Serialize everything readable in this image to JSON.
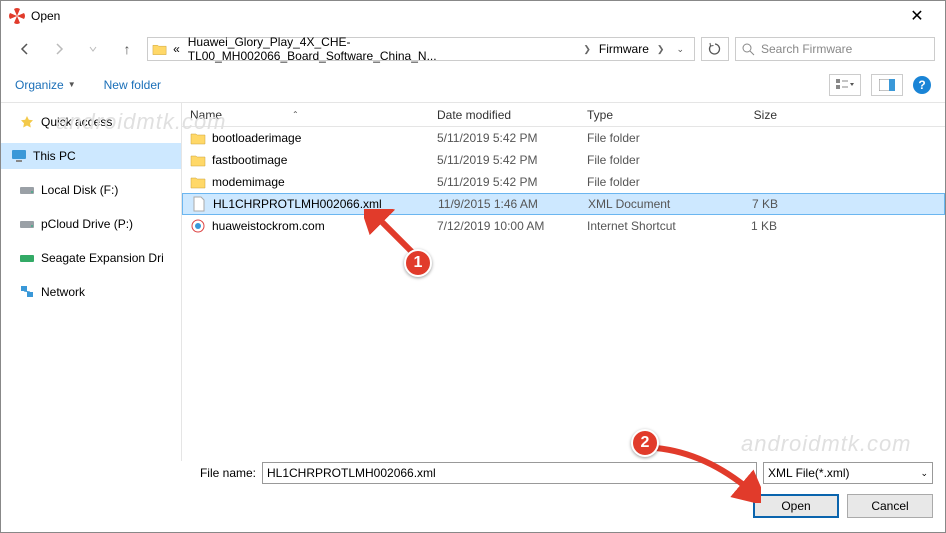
{
  "window": {
    "title": "Open"
  },
  "nav": {
    "crumb_prefix": "«",
    "crumb1": "Huawei_Glory_Play_4X_CHE-TL00_MH002066_Board_Software_China_N...",
    "crumb2": "Firmware"
  },
  "search": {
    "placeholder": "Search Firmware"
  },
  "toolbar": {
    "organize": "Organize",
    "newfolder": "New folder"
  },
  "columns": {
    "name": "Name",
    "date": "Date modified",
    "type": "Type",
    "size": "Size"
  },
  "sidebar": {
    "quick": "Quick access",
    "pc": "This PC",
    "drive_f": "Local Disk (F:)",
    "drive_p": "pCloud Drive (P:)",
    "drive_seagate": "Seagate Expansion Dri",
    "network": "Network"
  },
  "files": [
    {
      "name": "bootloaderimage",
      "date": "5/11/2019 5:42 PM",
      "type": "File folder",
      "size": ""
    },
    {
      "name": "fastbootimage",
      "date": "5/11/2019 5:42 PM",
      "type": "File folder",
      "size": ""
    },
    {
      "name": "modemimage",
      "date": "5/11/2019 5:42 PM",
      "type": "File folder",
      "size": ""
    },
    {
      "name": "HL1CHRPROTLMH002066.xml",
      "date": "11/9/2015 1:46 AM",
      "type": "XML Document",
      "size": "7 KB"
    },
    {
      "name": "huaweistockrom.com",
      "date": "7/12/2019 10:00 AM",
      "type": "Internet Shortcut",
      "size": "1 KB"
    }
  ],
  "footer": {
    "fname_label": "File name:",
    "fname_value": "HL1CHRPROTLMH002066.xml",
    "filter": "XML File(*.xml)",
    "open": "Open",
    "cancel": "Cancel"
  },
  "callouts": {
    "one": "1",
    "two": "2"
  },
  "watermarks": {
    "w1": "androidmtk.com",
    "w2": "androidmtk.com"
  }
}
